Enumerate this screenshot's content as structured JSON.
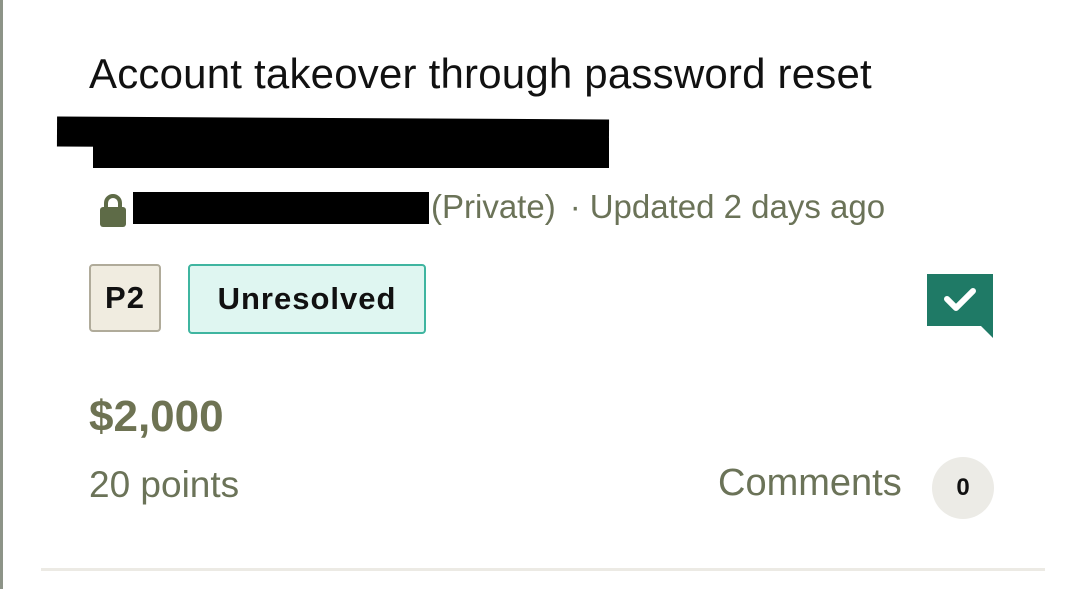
{
  "report": {
    "title": "Account takeover through password reset",
    "visibility": "(Private)",
    "separator": "·",
    "updated": "Updated 2 days ago",
    "priority": "P2",
    "status": "Unresolved",
    "bounty": "$2,000",
    "points": "20 points",
    "comments_label": "Comments",
    "comments_count": "0"
  },
  "icons": {
    "lock": "lock-icon",
    "verified": "verified-comment-icon"
  },
  "colors": {
    "muted_text": "#6b7358",
    "status_border": "#3fb5a0",
    "status_bg": "#dff6f1",
    "verified_green": "#1f7a66",
    "lock_green": "#5e6b47"
  }
}
